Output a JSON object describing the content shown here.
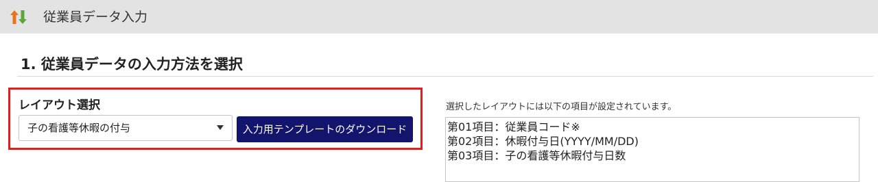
{
  "header": {
    "icon": "sort-arrows-icon",
    "title": "従業員データ入力"
  },
  "section": {
    "title": "1. 従業員データの入力方法を選択"
  },
  "layout_select": {
    "label": "レイアウト選択",
    "selected_value": "子の看護等休暇の付与",
    "download_button_label": "入力用テンプレートのダウンロード"
  },
  "fields_info": {
    "description": "選択したレイアウトには以下の項目が設定されています。",
    "fields": [
      "第01項目：従業員コード※",
      "第02項目：休暇付与日(YYYY/MM/DD)",
      "第03項目：子の看護等休暇付与日数"
    ]
  },
  "colors": {
    "header_bg": "#e3e3e3",
    "highlight_border": "#e01e1e",
    "button_bg": "#13146c",
    "arrow_orange": "#e8731c",
    "arrow_green": "#5aa83a"
  }
}
